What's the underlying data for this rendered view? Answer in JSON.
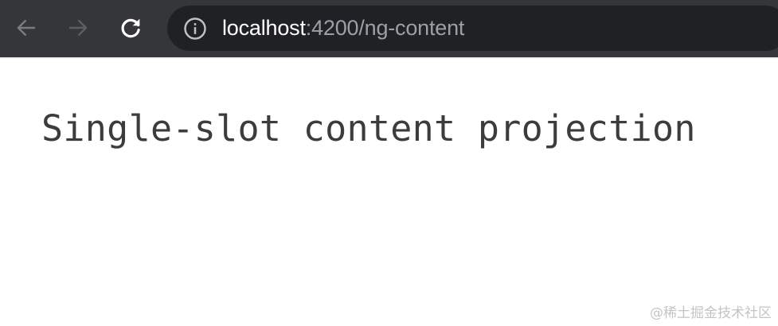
{
  "browser": {
    "address_bar": {
      "host": "localhost",
      "path": ":4200/ng-content"
    },
    "icons": {
      "back": "arrow-left-icon",
      "forward": "arrow-right-icon",
      "reload": "reload-icon",
      "site_info": "info-circle-icon"
    },
    "colors": {
      "toolbar": "#35363a",
      "omnibox": "#202124",
      "url_host": "#ffffff",
      "url_path": "#9aa0a6"
    }
  },
  "page": {
    "heading": "Single-slot content projection"
  },
  "watermark": "@稀土掘金技术社区"
}
